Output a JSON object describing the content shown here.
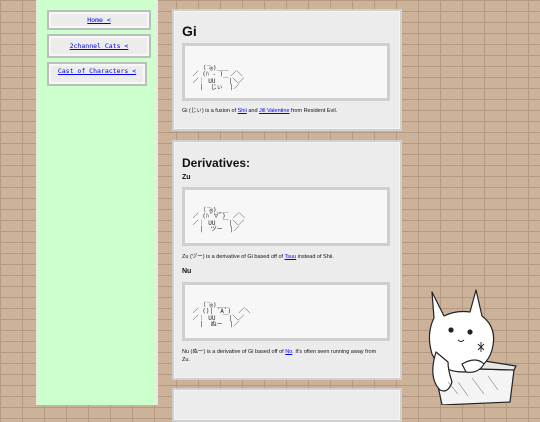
{
  "sidebar": {
    "items": [
      {
        "label": "Home <"
      },
      {
        "label": "2channel Cats <"
      },
      {
        "label": "Cast of Characters <"
      }
    ]
  },
  "gi": {
    "title": "Gi",
    "aa": "     _ \n   （ ◎)＿＿\n ／ (ﾊ ‐ )  ／＼\n ／｜ UU  ￣|＼／\n   |  じぃ  |／",
    "desc_before": "Gi (じぃ) is a fusion of ",
    "link1": "Shii",
    "desc_mid": " and ",
    "link2": "Jill Valentine",
    "desc_after": " from Resident Evil."
  },
  "derivatives": {
    "title": "Derivatives:",
    "zu": {
      "heading": "Zu",
      "aa": "     _ \n   （ ◎)＿＿\n ／ (ﾊ ﾟ∀ﾟ)  ／＼\n ／｜ UU  ￣|＼／\n   |  ヅー  |／",
      "desc_before": "Zu (ヅー) is a derivative of Gi based off of ",
      "link": "Tsuu",
      "desc_after": " instead of Shii."
    },
    "nu": {
      "heading": "Nu",
      "aa": "     _ \n   （ ◎)＿＿\n ／ ()| ´A`)  ／＼\n ／｜ UU  ￣|＼／\n   |  ぬー  |／",
      "desc_before": "Nu (ぬー) is a derivative of Gi based off of ",
      "link": "No",
      "desc_after": ". It's often seen running away from Zu."
    }
  }
}
